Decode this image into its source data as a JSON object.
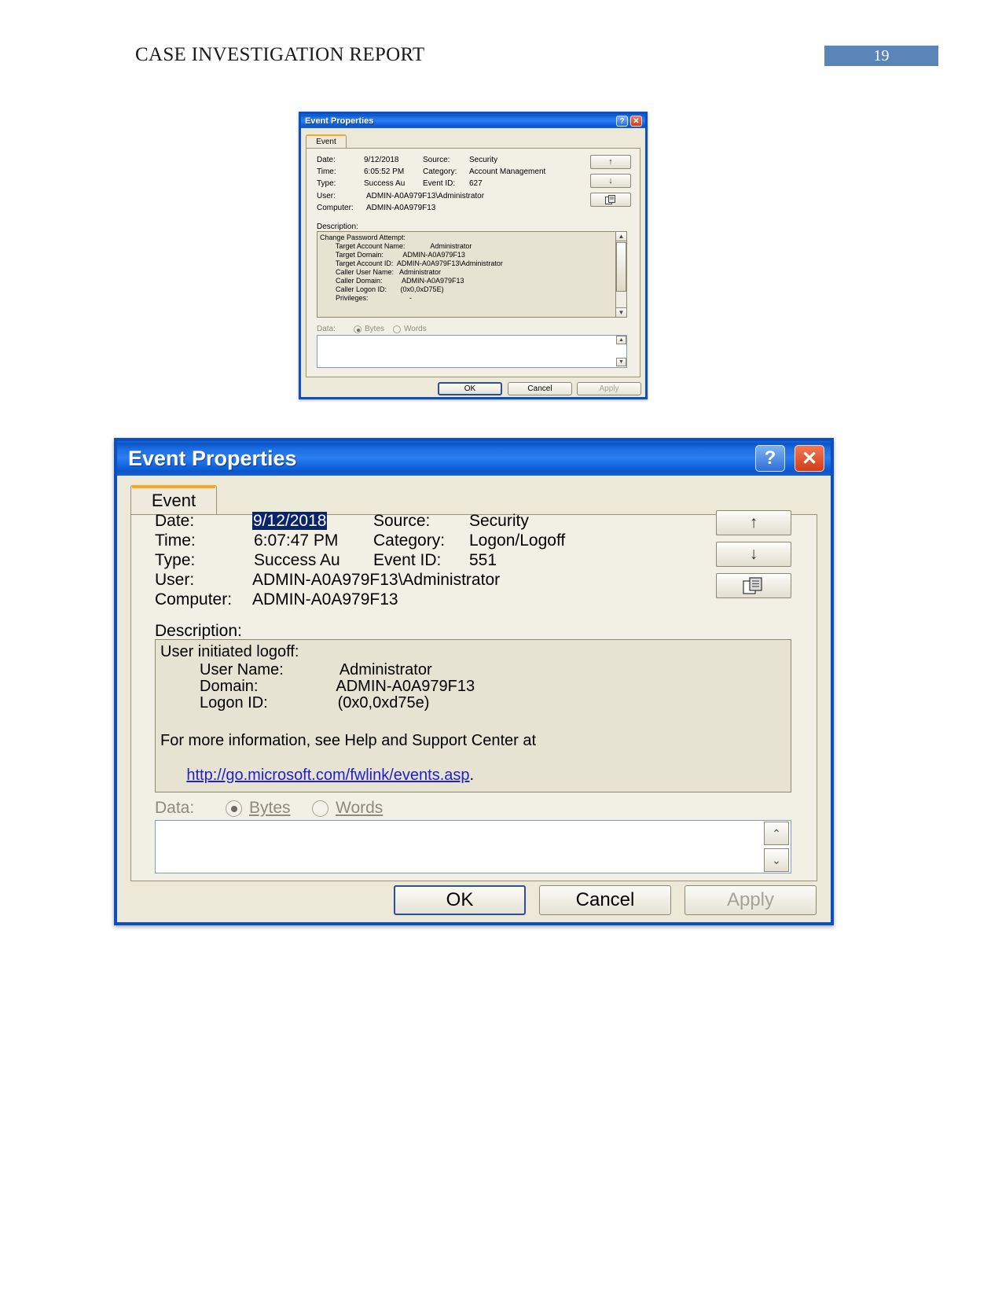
{
  "page": {
    "header_title": "CASE INVESTIGATION REPORT",
    "page_number": "19"
  },
  "dialog_small": {
    "title": "Event Properties",
    "help_btn": "?",
    "close_btn": "✕",
    "tab_label": "Event",
    "labels": {
      "date": "Date:",
      "time": "Time:",
      "type": "Type:",
      "user": "User:",
      "computer": "Computer:",
      "source": "Source:",
      "category": "Category:",
      "event_id": "Event ID:",
      "description": "Description:",
      "data": "Data:",
      "bytes": "Bytes",
      "words": "Words"
    },
    "values": {
      "date": "9/12/2018",
      "time": "6:05:52 PM",
      "type": "Success Au",
      "user": "ADMIN-A0A979F13\\Administrator",
      "computer": "ADMIN-A0A979F13",
      "source": "Security",
      "category": "Account Management",
      "event_id": "627"
    },
    "description_lines": [
      "Change Password Attempt:",
      "        Target Account Name:             Administrator",
      "        Target Domain:          ADMIN-A0A979F13",
      "        Target Account ID:  ADMIN-A0A979F13\\Administrator",
      "        Caller User Name:   Administrator",
      "        Caller Domain:          ADMIN-A0A979F13",
      "        Caller Logon ID:       (0x0,0xD75E)",
      "        Privileges:                     -"
    ],
    "data_selected": "Bytes",
    "buttons": {
      "ok": "OK",
      "cancel": "Cancel",
      "apply": "Apply"
    },
    "nav_icons": {
      "up": "↑",
      "down": "↓",
      "copy": "copy-icon"
    }
  },
  "dialog_large": {
    "title": "Event Properties",
    "help_btn": "?",
    "close_btn": "✕",
    "tab_label": "Event",
    "labels": {
      "date": "Date:",
      "time": "Time:",
      "type": "Type:",
      "user": "User:",
      "computer": "Computer:",
      "source": "Source:",
      "category": "Category:",
      "event_id": "Event ID:",
      "description": "Description:",
      "data": "Data:",
      "bytes": "Bytes",
      "words": "Words"
    },
    "values": {
      "date": "9/12/2018",
      "time": "6:07:47 PM",
      "type": "Success Au",
      "user": "ADMIN-A0A979F13\\Administrator",
      "computer": "ADMIN-A0A979F13",
      "source": "Security",
      "category": "Logon/Logoff",
      "event_id": "551"
    },
    "date_selected": true,
    "description_lines": [
      "User initiated logoff:",
      "         User Name:             Administrator",
      "         Domain:                  ADMIN-A0A979F13",
      "         Logon ID:                (0x0,0xd75e)"
    ],
    "description_footer": "For more information, see Help and Support Center at",
    "description_link": "http://go.microsoft.com/fwlink/events.asp",
    "description_link_suffix": ".",
    "data_selected": "Bytes",
    "buttons": {
      "ok": "OK",
      "cancel": "Cancel",
      "apply": "Apply"
    },
    "nav_icons": {
      "up": "↑",
      "down": "↓",
      "copy": "copy-icon"
    }
  }
}
